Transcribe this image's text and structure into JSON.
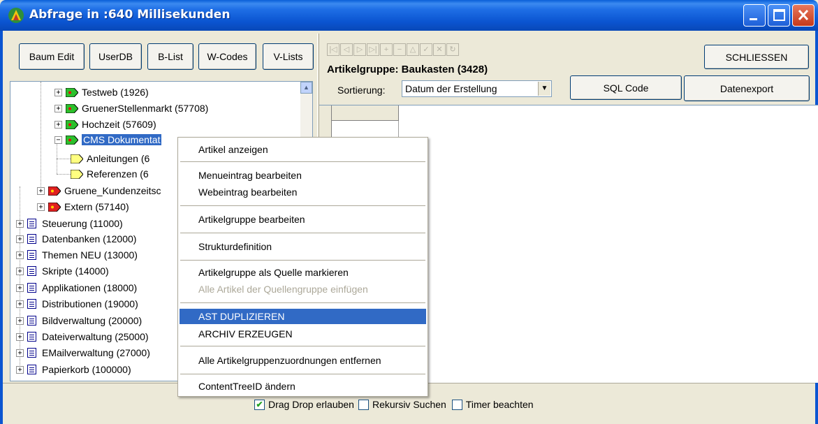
{
  "window": {
    "title": "Abfrage in :640 Millisekunden"
  },
  "toolbar_left": {
    "buttons": [
      "Baum Edit",
      "UserDB",
      "B-List",
      "W-Codes",
      "V-Lists"
    ]
  },
  "tree": {
    "items": [
      {
        "label": "Testweb (1926)",
        "kind": "green"
      },
      {
        "label": "GruenerStellenmarkt (57708)",
        "kind": "green"
      },
      {
        "label": "Hochzeit (57609)",
        "kind": "green"
      },
      {
        "label": "CMS Dokumentat",
        "kind": "green-selected"
      },
      {
        "label": "Anleitungen (6",
        "kind": "yellow"
      },
      {
        "label": "Referenzen (6",
        "kind": "yellow"
      },
      {
        "label": "Gruene_Kundenzeitsc",
        "kind": "red"
      },
      {
        "label": "Extern (57140)",
        "kind": "red"
      },
      {
        "label": "Steuerung (11000)",
        "kind": "list"
      },
      {
        "label": "Datenbanken (12000)",
        "kind": "list"
      },
      {
        "label": "Themen NEU (13000)",
        "kind": "list"
      },
      {
        "label": "Skripte (14000)",
        "kind": "list"
      },
      {
        "label": "Applikationen (18000)",
        "kind": "list"
      },
      {
        "label": "Distributionen (19000)",
        "kind": "list"
      },
      {
        "label": "Bildverwaltung (20000)",
        "kind": "list"
      },
      {
        "label": "Dateiverwaltung (25000)",
        "kind": "list"
      },
      {
        "label": "EMailverwaltung (27000)",
        "kind": "list"
      },
      {
        "label": "Papierkorb (100000)",
        "kind": "list"
      }
    ]
  },
  "right_panel": {
    "group_label": "Artikelgruppe: Baukasten (3428)",
    "sort_label": "Sortierung:",
    "sort_value": "Datum der Erstellung",
    "close_button": "SCHLIESSEN",
    "sql_button": "SQL Code",
    "export_button": "Datenexport"
  },
  "context_menu": {
    "items": [
      {
        "label": "Artikel anzeigen",
        "state": "normal"
      },
      {
        "label": "Menueintrag bearbeiten",
        "state": "normal"
      },
      {
        "label": "Webeintrag bearbeiten",
        "state": "normal"
      },
      {
        "label": "Artikelgruppe bearbeiten",
        "state": "normal"
      },
      {
        "label": "Strukturdefinition",
        "state": "normal"
      },
      {
        "label": "Artikelgruppe als Quelle markieren",
        "state": "normal"
      },
      {
        "label": "Alle Artikel der Quellengruppe einfügen",
        "state": "disabled"
      },
      {
        "label": "AST DUPLIZIEREN",
        "state": "highlighted"
      },
      {
        "label": "ARCHIV ERZEUGEN",
        "state": "normal"
      },
      {
        "label": "Alle Artikelgruppenzuordnungen entfernen",
        "state": "normal"
      },
      {
        "label": "ContentTreeID ändern",
        "state": "normal"
      }
    ]
  },
  "bottom": {
    "checkboxes": [
      {
        "label": "Drag Drop erlauben",
        "checked": true
      },
      {
        "label": "Rekursiv Suchen",
        "checked": false
      },
      {
        "label": "Timer beachten",
        "checked": false
      }
    ]
  },
  "colors": {
    "titlebar": "#0b55d1",
    "selection": "#316ac5",
    "face": "#ece9d8"
  }
}
